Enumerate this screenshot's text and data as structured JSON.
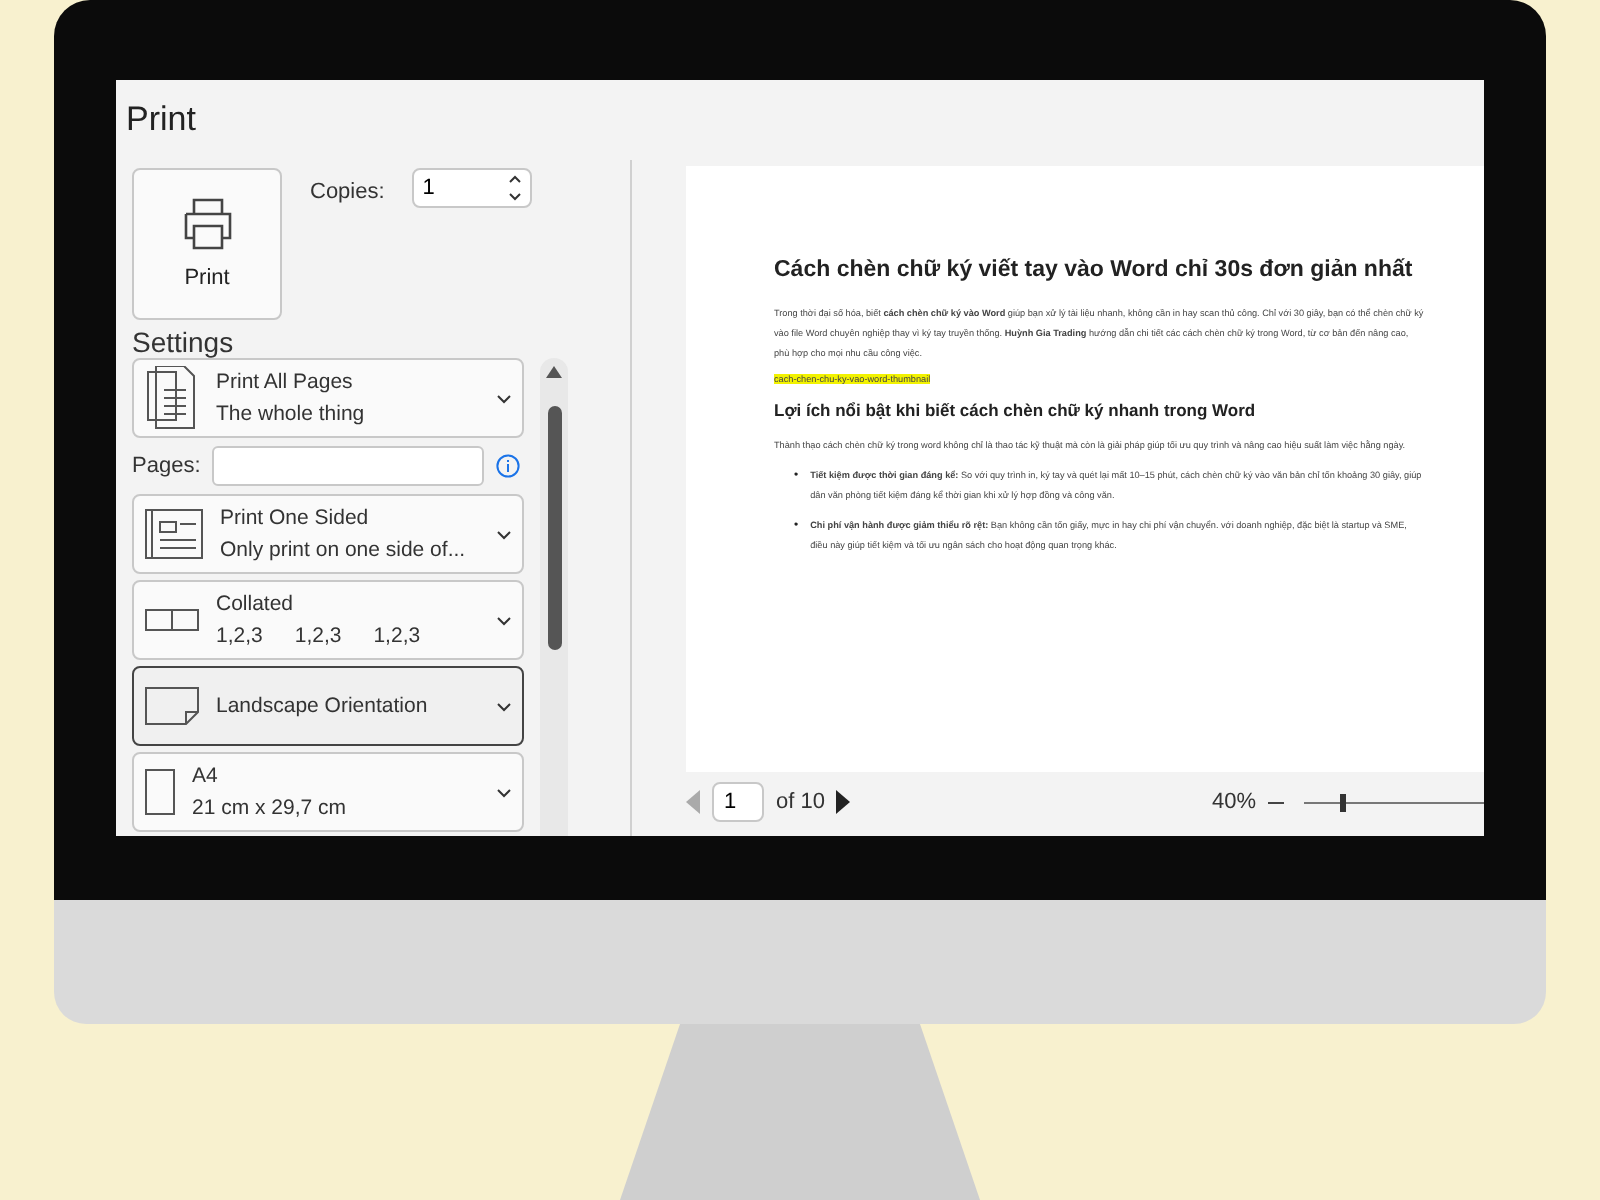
{
  "window": {
    "title": "Print"
  },
  "print_button": {
    "label": "Print"
  },
  "copies": {
    "label": "Copies:",
    "value": "1"
  },
  "settings": {
    "title": "Settings",
    "items": [
      {
        "kind": "pages",
        "title": "Print All Pages",
        "subtitle": "The whole thing",
        "focused": false
      },
      {
        "kind": "field",
        "label": "Pages:",
        "value": ""
      },
      {
        "kind": "sides",
        "title": "Print One Sided",
        "subtitle": "Only print on one side of...",
        "focused": false
      },
      {
        "kind": "collate",
        "title": "Collated",
        "subtitles": [
          "1,2,3",
          "1,2,3",
          "1,2,3"
        ],
        "focused": false
      },
      {
        "kind": "orientation",
        "title": "Landscape Orientation",
        "focused": true
      },
      {
        "kind": "paper",
        "title": "A4",
        "subtitle": "21 cm x 29,7 cm",
        "focused": false
      }
    ]
  },
  "preview": {
    "blocks": [
      {
        "kind": "heading",
        "text": "Cách chèn chữ ký viết tay vào Word chỉ 30s đơn giản nhất"
      },
      {
        "kind": "paragraph",
        "text": "Trong thời đại số hóa, biết **cách chèn chữ ký vào Word** giúp bạn xử lý tài liệu nhanh, không cần in hay scan thủ công. Chỉ với 30 giây, bạn có thể chèn chữ ký vào file Word chuyên nghiệp thay vì ký tay truyền thống. **Huỳnh Gia Trading** hướng dẫn chi tiết các cách chèn chữ ký trong Word, từ cơ bản đến nâng cao, phù hợp cho mọi nhu cầu công việc."
      },
      {
        "kind": "highlight",
        "text": "cach-chen-chu-ky-vao-word-thumbnail"
      },
      {
        "kind": "subheading",
        "text": "Lợi ích nổi bật khi biết cách chèn chữ ký nhanh trong Word"
      },
      {
        "kind": "paragraph",
        "text": "Thành thạo cách chèn chữ ký trong word không chỉ là thao tác kỹ thuật mà còn là giải pháp giúp tối ưu quy trình và nâng cao hiệu suất làm việc hằng ngày."
      },
      {
        "kind": "bullet",
        "marker": "•",
        "text": "**Tiết kiệm được thời gian đáng kể:** So với quy trình in, ký tay và quét lại mất 10–15 phút, cách chèn chữ ký vào văn bản chỉ tốn khoảng 30 giây, giúp dân văn phòng tiết kiệm đáng kể thời gian khi xử lý hợp đồng và công văn."
      },
      {
        "kind": "bullet",
        "marker": "•",
        "text": "**Chi phí vận hành được giảm thiểu rõ rệt:** Bạn không cần tốn giấy, mực in hay chi phí vận chuyển. với doanh nghiệp, đặc biệt là startup và SME, điều này giúp tiết kiệm và tối ưu ngân sách cho hoạt động quan trọng khác."
      }
    ]
  },
  "pager": {
    "page": "1",
    "total": "of 10"
  },
  "zoom": {
    "reading": "40%",
    "level": 0.2
  }
}
